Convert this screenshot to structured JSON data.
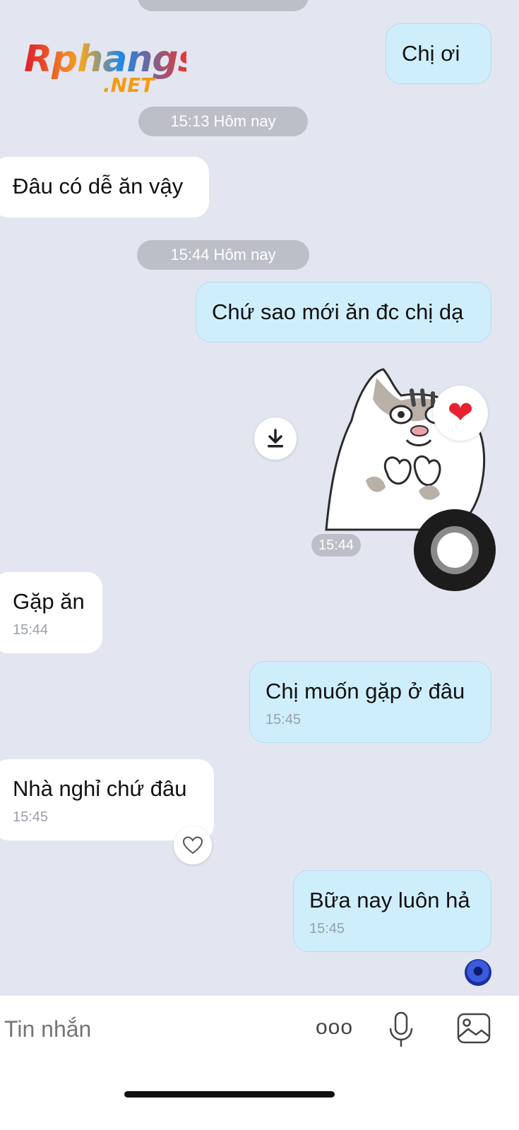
{
  "logo": {
    "line1": "Rphangs",
    "line2": ".NET"
  },
  "messages": {
    "m1": {
      "text": "Chị ơi"
    },
    "sep1": "15:13 Hôm nay",
    "m2": {
      "text": "Đâu có dễ ăn vậy"
    },
    "sep2": "15:44 Hôm nay",
    "m3": {
      "text": "Chứ sao mới ăn đc chị dạ"
    },
    "sticker": {
      "time": "15:44",
      "reaction": "❤"
    },
    "m4": {
      "text": "Gặp ăn",
      "time": "15:44"
    },
    "m5": {
      "text": "Chị muốn gặp ở đâu",
      "time": "15:45"
    },
    "m6": {
      "text": "Nhà nghỉ chứ đâu",
      "time": "15:45"
    },
    "m7": {
      "text": "Bữa nay luôn hả",
      "time": "15:45"
    }
  },
  "composer": {
    "placeholder": "Tin nhắn",
    "more_icon": "ooo"
  }
}
